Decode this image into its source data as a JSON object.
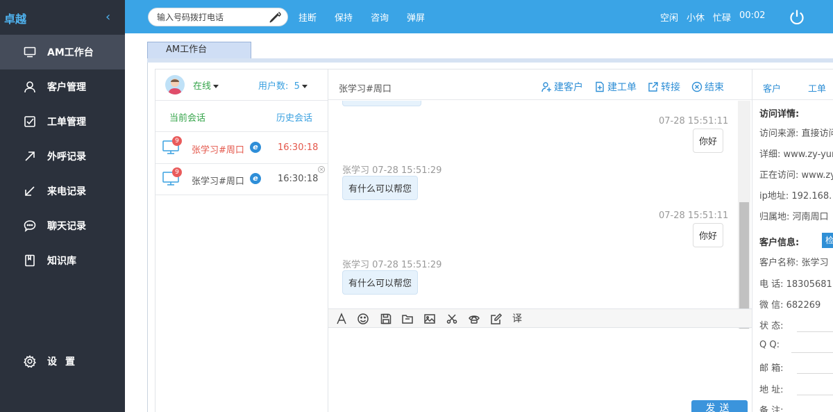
{
  "sidebar": {
    "brand": "卓越",
    "collapse": "‹",
    "items": [
      {
        "label": "AM工作台",
        "icon": "monitor-icon"
      },
      {
        "label": "客户管理",
        "icon": "user-icon"
      },
      {
        "label": "工单管理",
        "icon": "checkbox-icon"
      },
      {
        "label": "外呼记录",
        "icon": "arrow-up-right-icon"
      },
      {
        "label": "来电记录",
        "icon": "arrow-down-left-icon"
      },
      {
        "label": "聊天记录",
        "icon": "chat-bubble-icon"
      },
      {
        "label": "知识库",
        "icon": "book-icon"
      }
    ],
    "settings": "设置"
  },
  "topbar": {
    "dial_placeholder": "输入号码拨打电话",
    "actions": [
      "挂断",
      "保持",
      "咨询",
      "弹屏"
    ],
    "statuses": [
      "空闲",
      "小休",
      "忙碌"
    ],
    "timer": "00:02"
  },
  "tab": {
    "label": "AM工作台"
  },
  "sessions": {
    "online": "在线",
    "users_label": "用户数:",
    "users_count": "5",
    "tab_current": "当前会话",
    "tab_history": "历史会话",
    "rows": [
      {
        "badge": "9",
        "name": "张学习#周口",
        "browser": "e",
        "time": "16:30:18",
        "color": "#e4574b"
      },
      {
        "badge": "9",
        "name": "张学习#周口",
        "browser": "e",
        "time": "16:30:18",
        "color": "#555555"
      }
    ],
    "close_label": "×"
  },
  "chat": {
    "title": "张学习#周口",
    "actions": [
      "建客户",
      "建工单",
      "转接",
      "结束"
    ],
    "messages": [
      {
        "side": "right",
        "meta": "07-28 15:51:11",
        "text": "你好"
      },
      {
        "side": "left",
        "meta": "张学习 07-28 15:51:29",
        "text": "有什么可以帮您"
      },
      {
        "side": "right",
        "meta": "07-28 15:51:11",
        "text": "你好"
      },
      {
        "side": "left",
        "meta": "张学习 07-28 15:51:29",
        "text": "有什么可以帮您"
      }
    ],
    "send": "发送",
    "translate_label": "译"
  },
  "rpanel": {
    "tabs": [
      "客户",
      "工单"
    ],
    "visit_title": "访问详情:",
    "visit_rows": [
      "访问来源: 直接访问",
      "详细: www.zy-yun",
      "正在访问: www.zy",
      "ip地址: 192.168.",
      "归属地: 河南周口"
    ],
    "customer_title": "客户信息:",
    "check_btn": "检",
    "customer_rows": [
      "客户名称: 张学习",
      "电 话: 18305681",
      "微 信: 682269"
    ],
    "form_labels": [
      "状 态:",
      "Q Q:",
      "邮 箱:",
      "地 址:",
      "备 注:"
    ]
  }
}
